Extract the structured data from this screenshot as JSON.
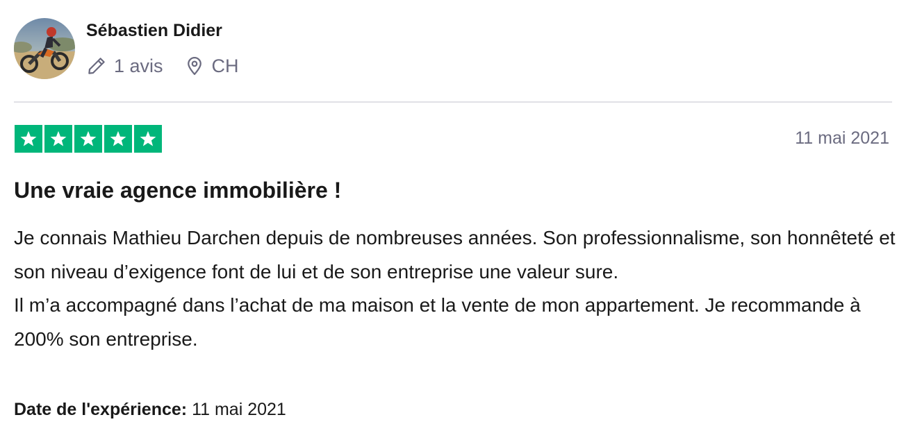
{
  "reviewer": {
    "name": "Sébastien Didier",
    "reviews_count": "1 avis",
    "country": "CH",
    "avatar_icon": "motocross-rider-photo",
    "count_icon": "pencil-icon",
    "location_icon": "location-pin-icon"
  },
  "review": {
    "rating": 5,
    "rating_max": 5,
    "star_color": "#00b67a",
    "date": "11 mai 2021",
    "title": "Une vraie agence immobilière !",
    "body": [
      "Je connais Mathieu Darchen depuis de nombreuses années. Son professionnalisme, son honnêteté et son niveau d’exigence font de lui et de son entreprise une valeur sure.",
      "Il m’a accompagné dans l’achat de ma maison et la vente de mon appartement. Je recommande à 200% son entreprise."
    ],
    "experience_label": "Date de l'expérience:",
    "experience_date": "11 mai 2021"
  }
}
